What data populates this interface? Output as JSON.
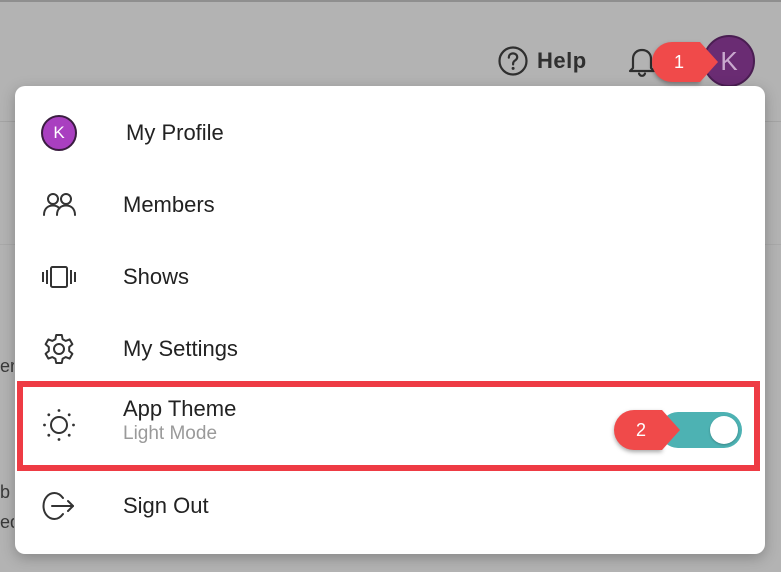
{
  "header": {
    "help_label": "Help",
    "avatar_initial": "K"
  },
  "background_fragments": [
    "er",
    "b",
    "ed"
  ],
  "menu": {
    "items": [
      {
        "label": "My Profile",
        "icon": "avatar-icon",
        "avatar_initial": "K"
      },
      {
        "label": "Members",
        "icon": "members-icon"
      },
      {
        "label": "Shows",
        "icon": "shows-icon"
      },
      {
        "label": "My Settings",
        "icon": "gear-icon"
      },
      {
        "label": "App Theme",
        "sublabel": "Light Mode",
        "icon": "sun-icon",
        "toggle_on": true
      },
      {
        "label": "Sign Out",
        "icon": "sign-out-icon"
      }
    ]
  },
  "callouts": [
    "1",
    "2"
  ],
  "colors": {
    "accent_toggle": "#4db2b3",
    "callout": "#f04a4a",
    "highlight": "#ee3b44",
    "avatar_top": "#6a2c73",
    "avatar_small": "#a93fc0"
  }
}
